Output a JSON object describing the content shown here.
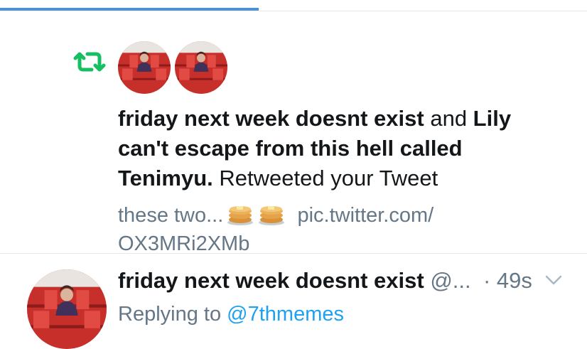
{
  "notification": {
    "icon": "retweet-icon",
    "actor_name": "friday next week doesnt exist",
    "connector": " and ",
    "second_actor": "Lily can't escape from this hell called Tenimyu.",
    "action": " Retweeted your Tweet",
    "preview_text": "these two...",
    "preview_link_a": "pic.twitter.com/",
    "preview_link_b": "OX3MRi2XMb"
  },
  "tweet": {
    "display_name": "friday next week doesnt exist",
    "handle": " @...",
    "time": "· 49s",
    "replying_label": "Replying to ",
    "replying_handle": "@7thmemes"
  },
  "colors": {
    "accent_blue": "#1da1f2",
    "tab_indicator": "#4a90e2",
    "retweet_green": "#17bf63",
    "secondary_text": "#657786",
    "avatar_red": "#d63a35"
  }
}
